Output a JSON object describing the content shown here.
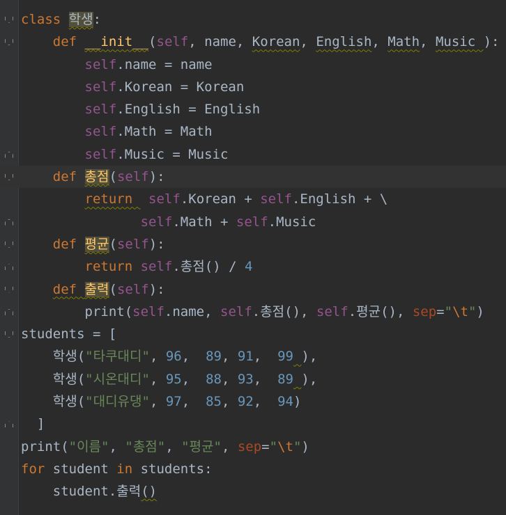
{
  "code_lines": [
    {
      "tokens": [
        {
          "t": "class ",
          "c": "kw"
        },
        {
          "t": "학생",
          "c": "plain hl squiggle"
        },
        {
          "t": ":",
          "c": "plain"
        }
      ],
      "fold": "open"
    },
    {
      "tokens": [
        {
          "t": "    "
        },
        {
          "t": "def ",
          "c": "kw"
        },
        {
          "t": "__init__",
          "c": "fn squiggle"
        },
        {
          "t": "("
        },
        {
          "t": "self",
          "c": "self"
        },
        {
          "t": ", name, "
        },
        {
          "t": "Korean",
          "c": "plain squiggle"
        },
        {
          "t": ", "
        },
        {
          "t": "English",
          "c": "plain squiggle"
        },
        {
          "t": ", "
        },
        {
          "t": "Math",
          "c": "plain squiggle"
        },
        {
          "t": ", "
        },
        {
          "t": "Music ",
          "c": "plain squiggle"
        },
        {
          "t": "):"
        }
      ],
      "fold": "open"
    },
    {
      "tokens": [
        {
          "t": "        "
        },
        {
          "t": "self",
          "c": "self"
        },
        {
          "t": ".name = name"
        }
      ]
    },
    {
      "tokens": [
        {
          "t": "        "
        },
        {
          "t": "self",
          "c": "self"
        },
        {
          "t": ".Korean = Korean"
        }
      ]
    },
    {
      "tokens": [
        {
          "t": "        "
        },
        {
          "t": "self",
          "c": "self"
        },
        {
          "t": ".English = English"
        }
      ]
    },
    {
      "tokens": [
        {
          "t": "        "
        },
        {
          "t": "self",
          "c": "self"
        },
        {
          "t": ".Math = Math"
        }
      ]
    },
    {
      "tokens": [
        {
          "t": "        "
        },
        {
          "t": "self",
          "c": "self"
        },
        {
          "t": ".Music = Music"
        }
      ],
      "fold": "close"
    },
    {
      "tokens": [
        {
          "t": "    "
        },
        {
          "t": "def ",
          "c": "kw"
        },
        {
          "t": "총점",
          "c": "fn hl squiggle"
        },
        {
          "t": "("
        },
        {
          "t": "self",
          "c": "self"
        },
        {
          "t": "):"
        }
      ],
      "fold": "open",
      "current": true
    },
    {
      "tokens": [
        {
          "t": "        "
        },
        {
          "t": "return ",
          "c": "kw squiggle"
        },
        {
          "t": " "
        },
        {
          "t": "self",
          "c": "self"
        },
        {
          "t": ".Korean + "
        },
        {
          "t": "self",
          "c": "self"
        },
        {
          "t": ".English + \\"
        }
      ]
    },
    {
      "tokens": [
        {
          "t": "               "
        },
        {
          "t": "self",
          "c": "self"
        },
        {
          "t": ".Math + "
        },
        {
          "t": "self",
          "c": "self"
        },
        {
          "t": ".Music"
        }
      ],
      "fold": "close"
    },
    {
      "tokens": [
        {
          "t": "    "
        },
        {
          "t": "def ",
          "c": "kw"
        },
        {
          "t": "평균",
          "c": "fn hl squiggle"
        },
        {
          "t": "("
        },
        {
          "t": "self",
          "c": "self"
        },
        {
          "t": "):"
        }
      ],
      "fold": "open"
    },
    {
      "tokens": [
        {
          "t": "        "
        },
        {
          "t": "return ",
          "c": "kw"
        },
        {
          "t": "self",
          "c": "self"
        },
        {
          "t": ".총점() / "
        },
        {
          "t": "4",
          "c": "num"
        }
      ],
      "fold": "close"
    },
    {
      "tokens": [
        {
          "t": "    "
        },
        {
          "t": "def ",
          "c": "kw squiggle"
        },
        {
          "t": "출력",
          "c": "fn hl squiggle"
        },
        {
          "t": "("
        },
        {
          "t": "self",
          "c": "self"
        },
        {
          "t": "):"
        }
      ],
      "fold": "open"
    },
    {
      "tokens": [
        {
          "t": "        print("
        },
        {
          "t": "self",
          "c": "self"
        },
        {
          "t": ".name, "
        },
        {
          "t": "self",
          "c": "self"
        },
        {
          "t": ".총점(), "
        },
        {
          "t": "self",
          "c": "self"
        },
        {
          "t": ".평균(), "
        },
        {
          "t": "sep",
          "c": "kwarg"
        },
        {
          "t": "="
        },
        {
          "t": "\"",
          "c": "str"
        },
        {
          "t": "\\t",
          "c": "escape"
        },
        {
          "t": "\"",
          "c": "str"
        },
        {
          "t": ")"
        }
      ],
      "fold": "close"
    },
    {
      "tokens": [
        {
          "t": "students = ["
        }
      ],
      "fold": "open"
    },
    {
      "tokens": [
        {
          "t": "    학생("
        },
        {
          "t": "\"타쿠대디\"",
          "c": "str"
        },
        {
          "t": ", "
        },
        {
          "t": "96",
          "c": "num"
        },
        {
          "t": ",  "
        },
        {
          "t": "89",
          "c": "num"
        },
        {
          "t": ", "
        },
        {
          "t": "91",
          "c": "num"
        },
        {
          "t": ",  "
        },
        {
          "t": "99",
          "c": "num"
        },
        {
          "t": " ",
          "c": "plain squiggle"
        },
        {
          "t": "),"
        }
      ]
    },
    {
      "tokens": [
        {
          "t": "    학생("
        },
        {
          "t": "\"시온대디\"",
          "c": "str"
        },
        {
          "t": ", "
        },
        {
          "t": "95",
          "c": "num"
        },
        {
          "t": ",  "
        },
        {
          "t": "88",
          "c": "num"
        },
        {
          "t": ", "
        },
        {
          "t": "93",
          "c": "num"
        },
        {
          "t": ",  "
        },
        {
          "t": "89",
          "c": "num"
        },
        {
          "t": " ",
          "c": "plain squiggle"
        },
        {
          "t": "),"
        }
      ]
    },
    {
      "tokens": [
        {
          "t": "    학생("
        },
        {
          "t": "\"대디유댕\"",
          "c": "str"
        },
        {
          "t": ", "
        },
        {
          "t": "97",
          "c": "num"
        },
        {
          "t": ",  "
        },
        {
          "t": "85",
          "c": "num"
        },
        {
          "t": ", "
        },
        {
          "t": "92",
          "c": "num"
        },
        {
          "t": ",  "
        },
        {
          "t": "94",
          "c": "num"
        },
        {
          "t": ")"
        }
      ]
    },
    {
      "tokens": [
        {
          "t": "  ]"
        }
      ],
      "fold": "close"
    },
    {
      "tokens": [
        {
          "t": "print("
        },
        {
          "t": "\"이름\"",
          "c": "str"
        },
        {
          "t": ", "
        },
        {
          "t": "\"총점\"",
          "c": "str"
        },
        {
          "t": ", "
        },
        {
          "t": "\"평균\"",
          "c": "str"
        },
        {
          "t": ", "
        },
        {
          "t": "sep",
          "c": "kwarg"
        },
        {
          "t": "="
        },
        {
          "t": "\"",
          "c": "str"
        },
        {
          "t": "\\t",
          "c": "escape"
        },
        {
          "t": "\"",
          "c": "str"
        },
        {
          "t": ")"
        }
      ]
    },
    {
      "tokens": [
        {
          "t": "for ",
          "c": "kw"
        },
        {
          "t": "student "
        },
        {
          "t": "in ",
          "c": "kw"
        },
        {
          "t": "students:"
        }
      ]
    },
    {
      "tokens": [
        {
          "t": "    student.출력"
        },
        {
          "t": "()",
          "c": "plain squiggle"
        }
      ]
    }
  ]
}
